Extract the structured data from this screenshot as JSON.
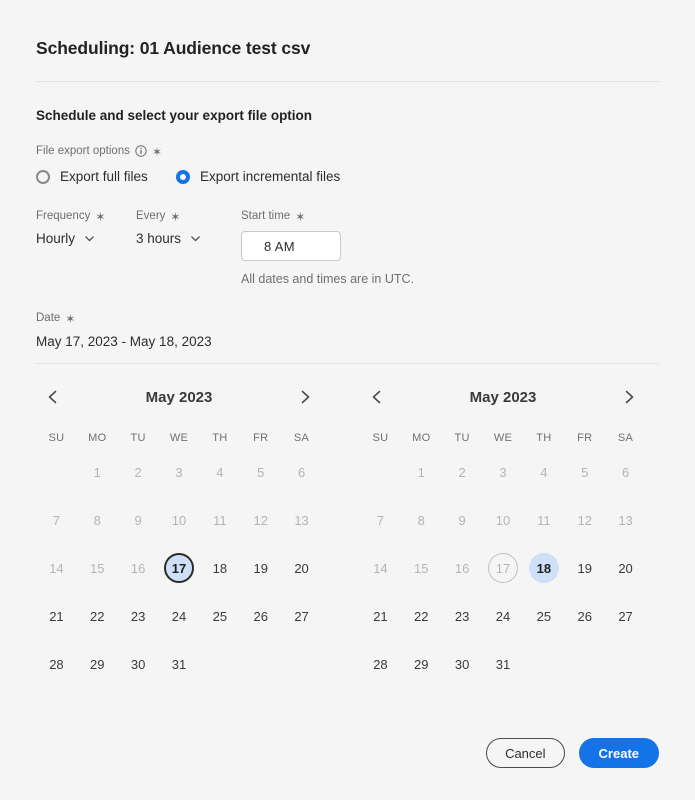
{
  "dialog": {
    "title": "Scheduling: 01 Audience test csv",
    "section_heading": "Schedule and select your export file option"
  },
  "export_options": {
    "label": "File export options",
    "info_icon": "info-circle-icon",
    "required_marker": "✶",
    "choices": [
      {
        "label": "Export full files",
        "selected": false
      },
      {
        "label": "Export incremental files",
        "selected": true
      }
    ]
  },
  "schedule": {
    "frequency": {
      "label": "Frequency",
      "value": "Hourly",
      "chevron": "chevron-down-icon"
    },
    "every": {
      "label": "Every",
      "value": "3 hours",
      "chevron": "chevron-down-icon"
    },
    "start_time": {
      "label": "Start time",
      "value": "8  AM"
    },
    "timezone_note": "All dates and times are in UTC."
  },
  "date": {
    "label": "Date",
    "range_value": "May 17, 2023 - May 18, 2023"
  },
  "calendars": {
    "weekdays": [
      "SU",
      "MO",
      "TU",
      "WE",
      "TH",
      "FR",
      "SA"
    ],
    "prev_icon": "chevron-left-icon",
    "next_icon": "chevron-right-icon",
    "left": {
      "title": "May 2023",
      "weeks": [
        [
          {
            "d": "",
            "s": "empty"
          },
          {
            "d": "1",
            "s": "disabled"
          },
          {
            "d": "2",
            "s": "disabled"
          },
          {
            "d": "3",
            "s": "disabled"
          },
          {
            "d": "4",
            "s": "disabled"
          },
          {
            "d": "5",
            "s": "disabled"
          },
          {
            "d": "6",
            "s": "disabled"
          }
        ],
        [
          {
            "d": "7",
            "s": "disabled"
          },
          {
            "d": "8",
            "s": "disabled"
          },
          {
            "d": "9",
            "s": "disabled"
          },
          {
            "d": "10",
            "s": "disabled"
          },
          {
            "d": "11",
            "s": "disabled"
          },
          {
            "d": "12",
            "s": "disabled"
          },
          {
            "d": "13",
            "s": "disabled"
          }
        ],
        [
          {
            "d": "14",
            "s": "disabled"
          },
          {
            "d": "15",
            "s": "disabled"
          },
          {
            "d": "16",
            "s": "disabled"
          },
          {
            "d": "17",
            "s": "focus"
          },
          {
            "d": "18",
            "s": ""
          },
          {
            "d": "19",
            "s": ""
          },
          {
            "d": "20",
            "s": ""
          }
        ],
        [
          {
            "d": "21",
            "s": ""
          },
          {
            "d": "22",
            "s": ""
          },
          {
            "d": "23",
            "s": ""
          },
          {
            "d": "24",
            "s": ""
          },
          {
            "d": "25",
            "s": ""
          },
          {
            "d": "26",
            "s": ""
          },
          {
            "d": "27",
            "s": ""
          }
        ],
        [
          {
            "d": "28",
            "s": ""
          },
          {
            "d": "29",
            "s": ""
          },
          {
            "d": "30",
            "s": ""
          },
          {
            "d": "31",
            "s": ""
          },
          {
            "d": "",
            "s": "empty"
          },
          {
            "d": "",
            "s": "empty"
          },
          {
            "d": "",
            "s": "empty"
          }
        ]
      ]
    },
    "right": {
      "title": "May 2023",
      "weeks": [
        [
          {
            "d": "",
            "s": "empty"
          },
          {
            "d": "1",
            "s": "disabled"
          },
          {
            "d": "2",
            "s": "disabled"
          },
          {
            "d": "3",
            "s": "disabled"
          },
          {
            "d": "4",
            "s": "disabled"
          },
          {
            "d": "5",
            "s": "disabled"
          },
          {
            "d": "6",
            "s": "disabled"
          }
        ],
        [
          {
            "d": "7",
            "s": "disabled"
          },
          {
            "d": "8",
            "s": "disabled"
          },
          {
            "d": "9",
            "s": "disabled"
          },
          {
            "d": "10",
            "s": "disabled"
          },
          {
            "d": "11",
            "s": "disabled"
          },
          {
            "d": "12",
            "s": "disabled"
          },
          {
            "d": "13",
            "s": "disabled"
          }
        ],
        [
          {
            "d": "14",
            "s": "disabled"
          },
          {
            "d": "15",
            "s": "disabled"
          },
          {
            "d": "16",
            "s": "disabled"
          },
          {
            "d": "17",
            "s": "outline"
          },
          {
            "d": "18",
            "s": "sel"
          },
          {
            "d": "19",
            "s": ""
          },
          {
            "d": "20",
            "s": ""
          }
        ],
        [
          {
            "d": "21",
            "s": ""
          },
          {
            "d": "22",
            "s": ""
          },
          {
            "d": "23",
            "s": ""
          },
          {
            "d": "24",
            "s": ""
          },
          {
            "d": "25",
            "s": ""
          },
          {
            "d": "26",
            "s": ""
          },
          {
            "d": "27",
            "s": ""
          }
        ],
        [
          {
            "d": "28",
            "s": ""
          },
          {
            "d": "29",
            "s": ""
          },
          {
            "d": "30",
            "s": ""
          },
          {
            "d": "31",
            "s": ""
          },
          {
            "d": "",
            "s": "empty"
          },
          {
            "d": "",
            "s": "empty"
          },
          {
            "d": "",
            "s": "empty"
          }
        ]
      ]
    }
  },
  "footer": {
    "cancel_label": "Cancel",
    "create_label": "Create"
  },
  "colors": {
    "accent": "#1473e6",
    "selection_fill": "#cde0f8",
    "background": "#f5f5f5"
  }
}
